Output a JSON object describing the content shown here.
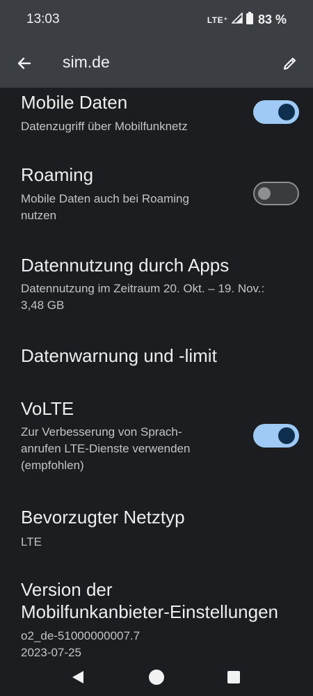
{
  "status": {
    "time": "13:03",
    "network": "LTE⁺",
    "battery": "83 %"
  },
  "appbar": {
    "title": "sim.de",
    "back_icon": "arrow-left-icon",
    "edit_icon": "pencil-icon"
  },
  "settings": {
    "mobile_data": {
      "title": "Mobile Daten",
      "subtitle": "Datenzugriff über Mobilfunknetz",
      "enabled": true
    },
    "roaming": {
      "title": "Roaming",
      "subtitle_line1": "Mobile Daten auch bei Roaming",
      "subtitle_line2": "nutzen",
      "enabled": false
    },
    "app_data_usage": {
      "title": "Datennutzung durch Apps",
      "subtitle_line1": "Datennutzung im Zeitraum 20. Okt. – 19. Nov.:",
      "subtitle_line2": "3,48 GB"
    },
    "data_warning": {
      "title": "Datenwarnung und -limit"
    },
    "volte": {
      "title": "VoLTE",
      "subtitle_line1": "Zur Verbesserung von Sprach-",
      "subtitle_line2": "anrufen LTE-Dienste verwenden",
      "subtitle_line3": "(empfohlen)",
      "enabled": true
    },
    "preferred_network": {
      "title": "Bevorzugter Netztyp",
      "subtitle": "LTE"
    },
    "carrier_version": {
      "title_line1": "Version der",
      "title_line2": "Mobilfunkanbieter-Einstellungen",
      "subtitle_line1": "o2_de-51000000007.7",
      "subtitle_line2": "2023-07-25"
    }
  },
  "navbar": {
    "back_icon": "triangle-back-icon",
    "home_icon": "circle-home-icon",
    "recents_icon": "square-recents-icon"
  }
}
